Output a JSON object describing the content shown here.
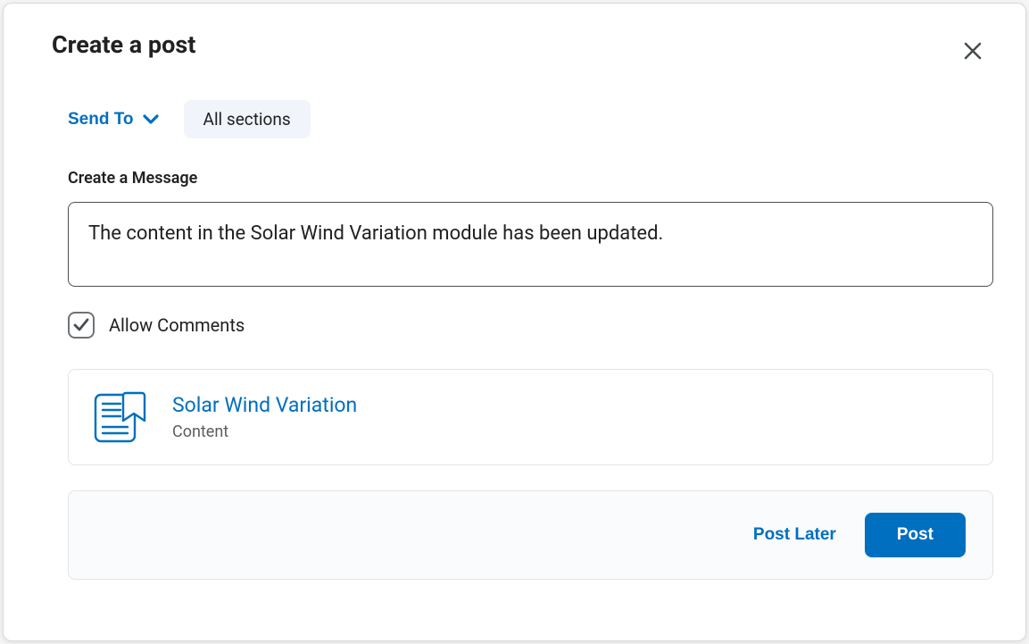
{
  "modal": {
    "title": "Create a post",
    "sendto_label": "Send To",
    "recipient_chip": "All sections",
    "message_label": "Create a Message",
    "message_value": "The content in the Solar Wind Variation module has been updated.",
    "allow_comments_label": "Allow Comments",
    "allow_comments_checked": true,
    "attachment": {
      "title": "Solar Wind Variation",
      "subtitle": "Content"
    },
    "footer": {
      "post_later_label": "Post Later",
      "post_label": "Post"
    }
  },
  "colors": {
    "primary": "#006fbf",
    "text": "#202122"
  }
}
